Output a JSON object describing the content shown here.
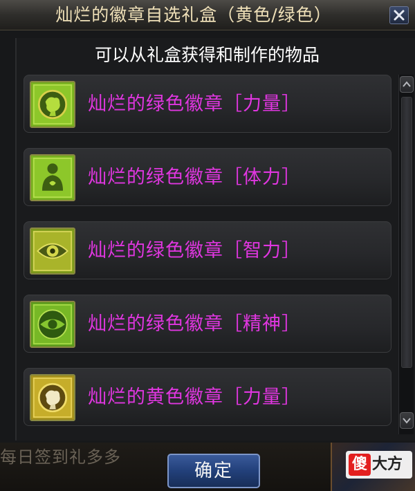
{
  "window": {
    "title": "灿烂的徽章自选礼盒（黄色/绿色）",
    "header": "可以从礼盒获得和制作的物品",
    "confirm_label": "确定"
  },
  "items": [
    {
      "label": "灿烂的绿色徽章［力量］",
      "icon": "green-fist-icon",
      "color": "#e036e0"
    },
    {
      "label": "灿烂的绿色徽章［体力］",
      "icon": "green-body-icon",
      "color": "#e036e0"
    },
    {
      "label": "灿烂的绿色徽章［智力］",
      "icon": "green-eye-icon",
      "color": "#e036e0"
    },
    {
      "label": "灿烂的绿色徽章［精神］",
      "icon": "green-spirit-eye-icon",
      "color": "#e036e0"
    },
    {
      "label": "灿烂的黄色徽章［力量］",
      "icon": "yellow-fist-icon",
      "color": "#e036e0"
    }
  ],
  "background": {
    "bottom_text": "每日签到礼多多"
  },
  "watermark": {
    "glyph": "傻",
    "text": "大方"
  }
}
